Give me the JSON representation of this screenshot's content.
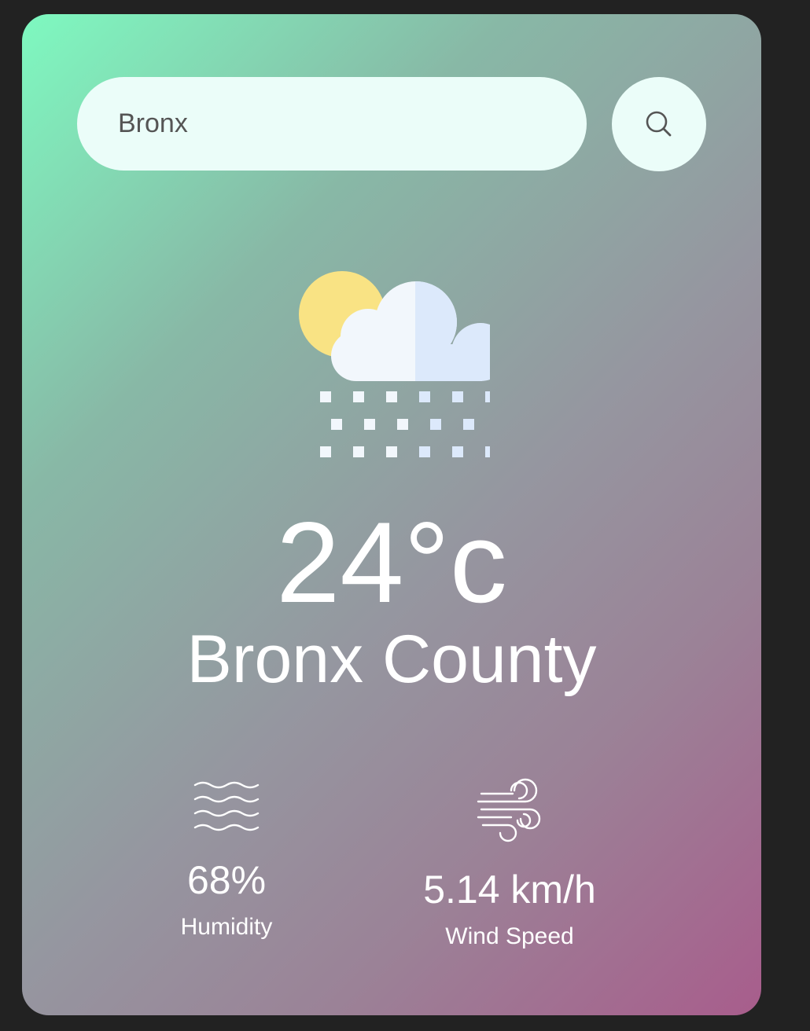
{
  "search": {
    "value": "Bronx",
    "placeholder": ""
  },
  "search_button": {
    "icon": "search-icon"
  },
  "weather": {
    "icon": "partly-cloudy-snow-icon",
    "temperature": "24°c",
    "city": "Bronx County"
  },
  "details": {
    "humidity": {
      "icon": "waves-icon",
      "value": "68%",
      "label": "Humidity"
    },
    "wind": {
      "icon": "wind-icon",
      "value": "5.14 km/h",
      "label": "Wind Speed"
    }
  },
  "colors": {
    "page_background": "#222222",
    "gradient_start": "#7ef9c0",
    "gradient_end": "#a85d8c",
    "input_background": "#ebfdf9",
    "text": "#ffffff"
  }
}
